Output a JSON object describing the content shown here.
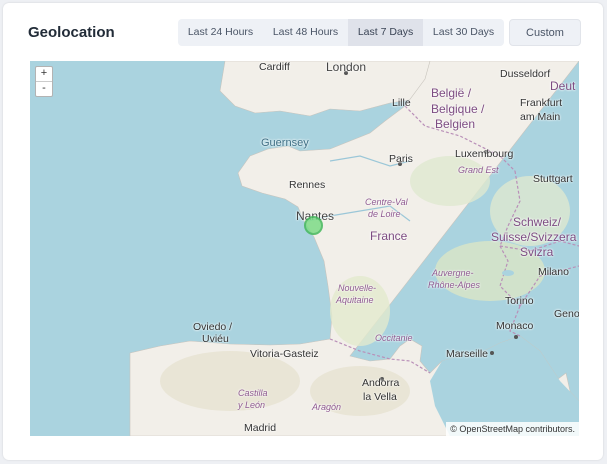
{
  "widget": {
    "title": "Geolocation"
  },
  "ranges": [
    {
      "label": "Last 24 Hours",
      "active": false
    },
    {
      "label": "Last 48 Hours",
      "active": false
    },
    {
      "label": "Last 7 Days",
      "active": true
    },
    {
      "label": "Last 30 Days",
      "active": false
    }
  ],
  "custom_label": "Custom",
  "map": {
    "zoom_in": "+",
    "zoom_out": "-",
    "attribution": "© OpenStreetMap contributors.",
    "labels": {
      "cardiff": "Cardiff",
      "london": "London",
      "dusseldorf": "Dusseldorf",
      "deutschland": "Deut",
      "lille": "Lille",
      "belgie1": "België /",
      "belgie2": "Belgique /",
      "belgie3": "Belgien",
      "frankfurt1": "Frankfurt",
      "frankfurt2": "am Main",
      "guernsey": "Guernsey",
      "paris": "Paris",
      "luxembourg": "Luxembourg",
      "grandest": "Grand Est",
      "stuttgart": "Stuttgart",
      "rennes": "Rennes",
      "nantes": "Nantes",
      "centreval1": "Centre-Val",
      "centreval2": "de Loire",
      "france": "France",
      "schweiz1": "Schweiz/",
      "schweiz2": "Suisse/Svizzera",
      "schweiz3": "Svizra",
      "auvergne1": "Auvergne-",
      "auvergne2": "Rhône-Alpes",
      "milano": "Milano",
      "nouvelle1": "Nouvelle-",
      "nouvelle2": "Aquitaine",
      "torino": "Torino",
      "genova": "Geno",
      "oviedo1": "Oviedo /",
      "oviedo2": "Uviéu",
      "occitanie": "Occitanie",
      "monaco": "Monaco",
      "vitoria": "Vitoria-Gasteiz",
      "marseille": "Marseille",
      "andorra1": "Andorra",
      "andorra2": "la Vella",
      "castilla1": "Castilla",
      "castilla2": "y León",
      "aragon": "Aragón",
      "madrid": "Madrid"
    }
  }
}
